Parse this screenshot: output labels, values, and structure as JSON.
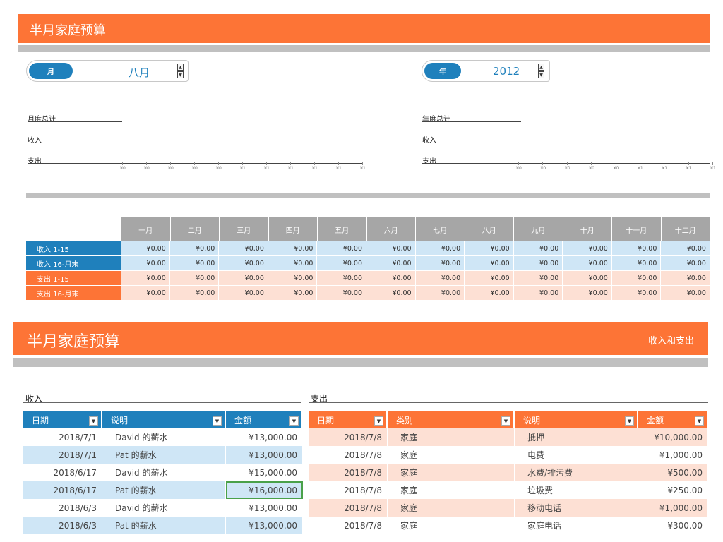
{
  "top": {
    "title": "半月家庭预算",
    "month_spinner": {
      "label": "月",
      "value": "八月"
    },
    "year_spinner": {
      "label": "年",
      "value": "2012"
    },
    "left_metrics": [
      "月度总计",
      "收入",
      "支出"
    ],
    "right_metrics": [
      "年度总计",
      "收入",
      "支出"
    ],
    "axis_ticks": [
      "¥0",
      "¥0",
      "¥0",
      "¥0",
      "¥0",
      "¥1",
      "¥1",
      "¥1",
      "¥1",
      "¥1",
      "¥1"
    ],
    "months": [
      "一月",
      "二月",
      "三月",
      "四月",
      "五月",
      "六月",
      "七月",
      "八月",
      "九月",
      "十月",
      "十一月",
      "十二月"
    ],
    "rows": [
      {
        "label": "收入 1-15",
        "type": "inc",
        "values": [
          "¥0.00",
          "¥0.00",
          "¥0.00",
          "¥0.00",
          "¥0.00",
          "¥0.00",
          "¥0.00",
          "¥0.00",
          "¥0.00",
          "¥0.00",
          "¥0.00",
          "¥0.00"
        ]
      },
      {
        "label": "收入 16-月末",
        "type": "inc",
        "values": [
          "¥0.00",
          "¥0.00",
          "¥0.00",
          "¥0.00",
          "¥0.00",
          "¥0.00",
          "¥0.00",
          "¥0.00",
          "¥0.00",
          "¥0.00",
          "¥0.00",
          "¥0.00"
        ]
      },
      {
        "label": "支出 1-15",
        "type": "exp",
        "values": [
          "¥0.00",
          "¥0.00",
          "¥0.00",
          "¥0.00",
          "¥0.00",
          "¥0.00",
          "¥0.00",
          "¥0.00",
          "¥0.00",
          "¥0.00",
          "¥0.00",
          "¥0.00"
        ]
      },
      {
        "label": "支出 16-月末",
        "type": "exp",
        "values": [
          "¥0.00",
          "¥0.00",
          "¥0.00",
          "¥0.00",
          "¥0.00",
          "¥0.00",
          "¥0.00",
          "¥0.00",
          "¥0.00",
          "¥0.00",
          "¥0.00",
          "¥0.00"
        ]
      }
    ]
  },
  "bottom": {
    "title": "半月家庭预算",
    "nav_label": "收入和支出",
    "income": {
      "section_title": "收入",
      "headers": [
        "日期",
        "说明",
        "金额"
      ],
      "rows": [
        [
          "2018/7/1",
          "David 的薪水",
          "¥13,000.00"
        ],
        [
          "2018/7/1",
          "Pat 的薪水",
          "¥13,000.00"
        ],
        [
          "2018/6/17",
          "David 的薪水",
          "¥15,000.00"
        ],
        [
          "2018/6/17",
          "Pat 的薪水",
          "¥16,000.00"
        ],
        [
          "2018/6/3",
          "David 的薪水",
          "¥13,000.00"
        ],
        [
          "2018/6/3",
          "Pat 的薪水",
          "¥13,000.00"
        ]
      ]
    },
    "expense": {
      "section_title": "支出",
      "headers": [
        "日期",
        "类别",
        "说明",
        "金额"
      ],
      "rows": [
        [
          "2018/7/8",
          "家庭",
          "抵押",
          "¥10,000.00"
        ],
        [
          "2018/7/8",
          "家庭",
          "电费",
          "¥1,000.00"
        ],
        [
          "2018/7/8",
          "家庭",
          "水费/排污费",
          "¥500.00"
        ],
        [
          "2018/7/8",
          "家庭",
          "垃圾费",
          "¥250.00"
        ],
        [
          "2018/7/8",
          "家庭",
          "移动电话",
          "¥1,000.00"
        ],
        [
          "2018/7/8",
          "家庭",
          "家庭电话",
          "¥300.00"
        ]
      ]
    }
  }
}
